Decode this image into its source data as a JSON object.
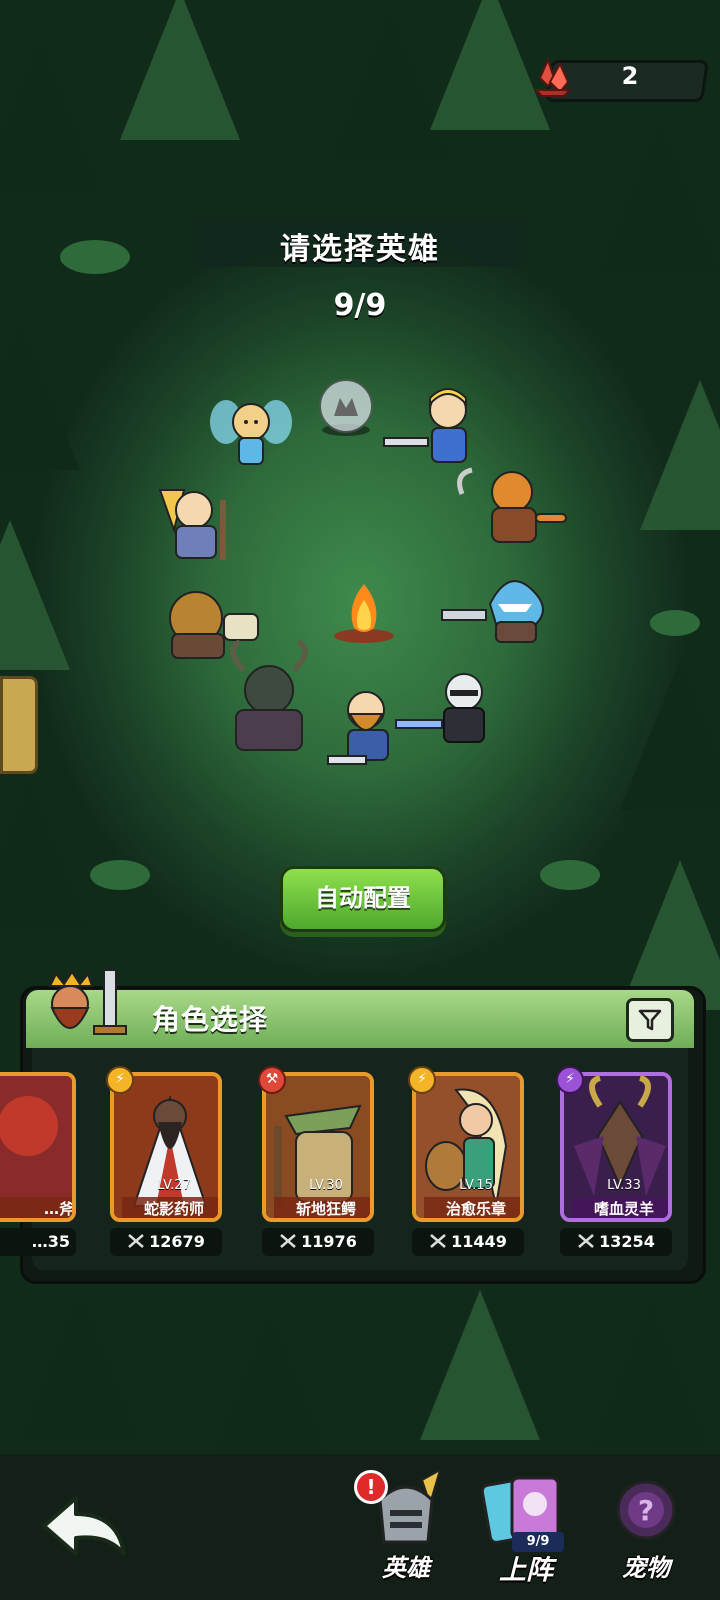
{
  "currency": {
    "icon": "red-crystal-icon",
    "count": "2"
  },
  "header": {
    "title": "请选择英雄",
    "selected_count": "9/9"
  },
  "auto_button": {
    "label": "自动配置"
  },
  "panel": {
    "title": "角色选择",
    "cards": [
      {
        "name": "…斧",
        "level": "",
        "power": "…35",
        "type": "atk",
        "partial": true
      },
      {
        "name": "蛇影药师",
        "level": "LV.27",
        "power": "12679",
        "type": "energy"
      },
      {
        "name": "斩地狂鳄",
        "level": "LV.30",
        "power": "11976",
        "type": "atk"
      },
      {
        "name": "治愈乐章",
        "level": "LV.15",
        "power": "11449",
        "type": "energy"
      },
      {
        "name": "嗜血灵羊",
        "level": "LV.33",
        "power": "13254",
        "type": "purple"
      }
    ]
  },
  "nav": {
    "heroes_label": "英雄",
    "lineup_label": "上阵",
    "lineup_count": "9/9",
    "pets_label": "宠物",
    "badge": "!"
  },
  "colors": {
    "accent_green": "#6fae57",
    "card_gold": "#e89a2c",
    "card_purple": "#b06ee0"
  }
}
